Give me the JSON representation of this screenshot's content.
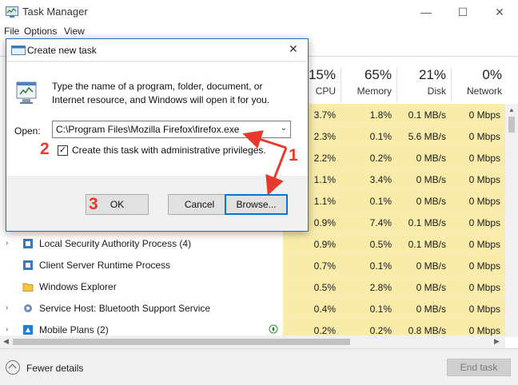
{
  "window": {
    "title": "Task Manager",
    "controls": {
      "minimize": "—",
      "maximize": "☐",
      "close": "✕"
    }
  },
  "menubar": [
    "File",
    "Options",
    "View"
  ],
  "columns": [
    {
      "pct": "15%",
      "name": "CPU"
    },
    {
      "pct": "65%",
      "name": "Memory"
    },
    {
      "pct": "21%",
      "name": "Disk"
    },
    {
      "pct": "0%",
      "name": "Network"
    }
  ],
  "rows": [
    {
      "name": "",
      "cpu": "3.7%",
      "memory": "1.8%",
      "disk": "0.1 MB/s",
      "network": "0 Mbps"
    },
    {
      "name": "",
      "cpu": "2.3%",
      "memory": "0.1%",
      "disk": "5.6 MB/s",
      "network": "0 Mbps"
    },
    {
      "name": "",
      "cpu": "2.2%",
      "memory": "0.2%",
      "disk": "0 MB/s",
      "network": "0 Mbps"
    },
    {
      "name": "",
      "cpu": "1.1%",
      "memory": "3.4%",
      "disk": "0 MB/s",
      "network": "0 Mbps"
    },
    {
      "name": "",
      "cpu": "1.1%",
      "memory": "0.1%",
      "disk": "0 MB/s",
      "network": "0 Mbps"
    },
    {
      "name": "",
      "cpu": "0.9%",
      "memory": "7.4%",
      "disk": "0.1 MB/s",
      "network": "0 Mbps"
    },
    {
      "name": "Local Security Authority Process (4)",
      "cpu": "0.9%",
      "memory": "0.5%",
      "disk": "0.1 MB/s",
      "network": "0 Mbps",
      "icon": "lsa-icon",
      "expandable": true
    },
    {
      "name": "Client Server Runtime Process",
      "cpu": "0.7%",
      "memory": "0.1%",
      "disk": "0 MB/s",
      "network": "0 Mbps",
      "icon": "csrss-icon",
      "expandable": false
    },
    {
      "name": "Windows Explorer",
      "cpu": "0.5%",
      "memory": "2.8%",
      "disk": "0 MB/s",
      "network": "0 Mbps",
      "icon": "folder-icon",
      "expandable": false
    },
    {
      "name": "Service Host: Bluetooth Support Service",
      "cpu": "0.4%",
      "memory": "0.1%",
      "disk": "0 MB/s",
      "network": "0 Mbps",
      "icon": "gear-icon",
      "expandable": true
    },
    {
      "name": "Mobile Plans (2)",
      "cpu": "0.2%",
      "memory": "0.2%",
      "disk": "0.8 MB/s",
      "network": "0 Mbps",
      "icon": "mobile-plans-icon",
      "expandable": true,
      "suspended": true
    }
  ],
  "footer": {
    "fewer_details": "Fewer details",
    "end_task": "End task"
  },
  "dialog": {
    "title": "Create new task",
    "description": "Type the name of a program, folder, document, or Internet resource, and Windows will open it for you.",
    "open_label": "Open:",
    "open_value": "C:\\Program Files\\Mozilla Firefox\\firefox.exe",
    "admin_label": "Create this task with administrative privileges.",
    "admin_checked": true,
    "ok": "OK",
    "cancel": "Cancel",
    "browse": "Browse..."
  },
  "annotations": [
    "1",
    "2",
    "3"
  ],
  "colors": {
    "accent": "#0078d7",
    "cell_highlight": "#f9ecaa",
    "annotation": "#e63a2e"
  }
}
